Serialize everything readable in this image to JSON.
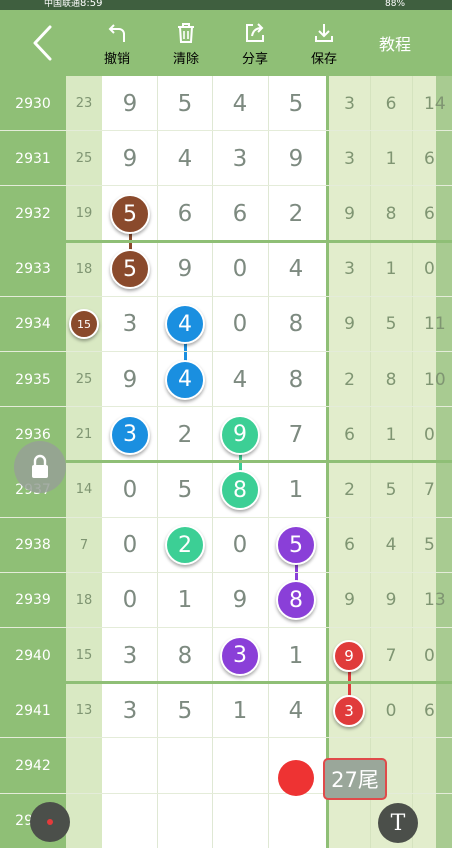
{
  "status_bar": {
    "carrier": "中国联通",
    "time": "8:59",
    "battery": "88%"
  },
  "toolbar": {
    "back_icon": "chevron-left-icon",
    "items": [
      {
        "label": "撤销",
        "icon": "undo-icon"
      },
      {
        "label": "清除",
        "icon": "trash-icon"
      },
      {
        "label": "分享",
        "icon": "share-icon"
      },
      {
        "label": "保存",
        "icon": "download-icon"
      }
    ],
    "tutorial_label": "教程"
  },
  "rows": [
    {
      "issue": "2930",
      "sum": "23",
      "digits": [
        "9",
        "5",
        "4",
        "5"
      ],
      "right": [
        "3",
        "6",
        "14"
      ]
    },
    {
      "issue": "2931",
      "sum": "25",
      "digits": [
        "9",
        "4",
        "3",
        "9"
      ],
      "right": [
        "3",
        "1",
        "6"
      ]
    },
    {
      "issue": "2932",
      "sum": "19",
      "digits": [
        "5",
        "6",
        "6",
        "2"
      ],
      "right": [
        "9",
        "8",
        "6"
      ]
    },
    {
      "issue": "2933",
      "sum": "18",
      "digits": [
        "5",
        "9",
        "0",
        "4"
      ],
      "right": [
        "3",
        "1",
        "0"
      ]
    },
    {
      "issue": "2934",
      "sum": "15",
      "digits": [
        "3",
        "4",
        "0",
        "8"
      ],
      "right": [
        "9",
        "5",
        "11"
      ]
    },
    {
      "issue": "2935",
      "sum": "25",
      "digits": [
        "9",
        "4",
        "4",
        "8"
      ],
      "right": [
        "2",
        "8",
        "10"
      ]
    },
    {
      "issue": "2936",
      "sum": "21",
      "digits": [
        "3",
        "2",
        "9",
        "7"
      ],
      "right": [
        "6",
        "1",
        "0"
      ]
    },
    {
      "issue": "2937",
      "sum": "14",
      "digits": [
        "0",
        "5",
        "8",
        "1"
      ],
      "right": [
        "2",
        "5",
        "7"
      ]
    },
    {
      "issue": "2938",
      "sum": "7",
      "digits": [
        "0",
        "2",
        "0",
        "5"
      ],
      "right": [
        "6",
        "4",
        "5"
      ]
    },
    {
      "issue": "2939",
      "sum": "18",
      "digits": [
        "0",
        "1",
        "9",
        "8"
      ],
      "right": [
        "9",
        "9",
        "13"
      ]
    },
    {
      "issue": "2940",
      "sum": "15",
      "digits": [
        "3",
        "8",
        "3",
        "1"
      ],
      "right": [
        "9",
        "7",
        "0"
      ]
    },
    {
      "issue": "2941",
      "sum": "13",
      "digits": [
        "3",
        "5",
        "1",
        "4"
      ],
      "right": [
        "3",
        "0",
        "6"
      ]
    },
    {
      "issue": "2942",
      "sum": "",
      "digits": [
        "",
        "",
        "",
        ""
      ],
      "right": [
        "",
        "",
        ""
      ]
    },
    {
      "issue": "2943",
      "sum": "",
      "digits": [
        "",
        "",
        "",
        ""
      ],
      "right": [
        "",
        "",
        ""
      ]
    }
  ],
  "markers": [
    {
      "row": 2,
      "col": 0,
      "value": "5",
      "color": "#8a4a2c"
    },
    {
      "row": 3,
      "col": 0,
      "value": "5",
      "color": "#8a4a2c"
    },
    {
      "row": 4,
      "col": 1,
      "value": "4",
      "color": "#1a8fe0"
    },
    {
      "row": 5,
      "col": 1,
      "value": "4",
      "color": "#1a8fe0"
    },
    {
      "row": 6,
      "col": 0,
      "value": "3",
      "color": "#1a8fe0"
    },
    {
      "row": 6,
      "col": 2,
      "value": "9",
      "color": "#3ccf95"
    },
    {
      "row": 7,
      "col": 2,
      "value": "8",
      "color": "#3ccf95"
    },
    {
      "row": 8,
      "col": 1,
      "value": "2",
      "color": "#3ccf95"
    },
    {
      "row": 8,
      "col": 3,
      "value": "5",
      "color": "#8a3fd8"
    },
    {
      "row": 9,
      "col": 3,
      "value": "8",
      "color": "#8a3fd8"
    },
    {
      "row": 10,
      "col": 2,
      "value": "3",
      "color": "#8a3fd8"
    },
    {
      "row": 10,
      "col": 4,
      "value": "9",
      "color": "#e03b3b"
    },
    {
      "row": 11,
      "col": 4,
      "value": "3",
      "color": "#e03b3b"
    }
  ],
  "sum_marker": {
    "row": 4,
    "value": "15",
    "color": "#8a4a2c"
  },
  "tail_label": "27尾",
  "colors": {
    "header": "#8fbf76",
    "accent_red": "#e04a4a"
  },
  "float_buttons": {
    "lock_icon": "lock-icon",
    "t_label": "T",
    "dot_icon": "red-dot-icon"
  }
}
